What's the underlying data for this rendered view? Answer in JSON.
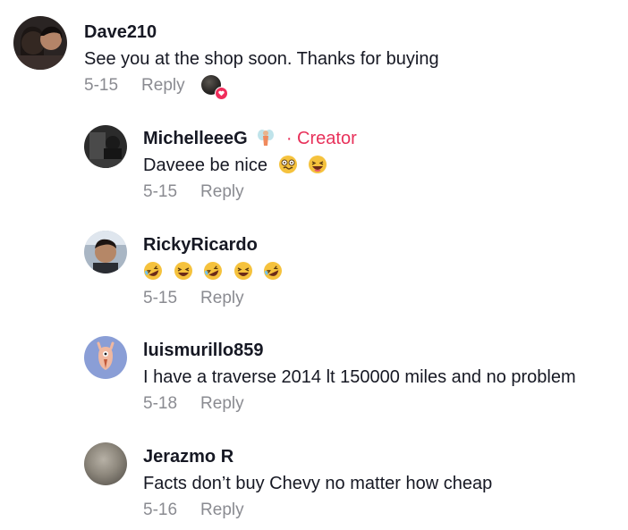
{
  "comments": [
    {
      "username": "Dave210",
      "text": "See you at the shop soon. Thanks for buying",
      "date": "5-15",
      "reply_label": "Reply",
      "liked_by_creator": true
    },
    {
      "username": "MichelleeeG",
      "username_icon": "fairy-emoji",
      "creator_tag": "· Creator",
      "text": "Daveee be nice",
      "text_emojis": [
        "woozy-face-emoji",
        "laughing-face-emoji"
      ],
      "date": "5-15",
      "reply_label": "Reply"
    },
    {
      "username": "RickyRicardo",
      "text": "",
      "text_emojis": [
        "rofl-emoji",
        "laughing-face-emoji",
        "rofl-emoji",
        "laughing-face-emoji",
        "rofl-emoji"
      ],
      "date": "5-15",
      "reply_label": "Reply"
    },
    {
      "username": "luismurillo859",
      "text": "I have a traverse 2014 lt 150000 miles and no problem",
      "date": "5-18",
      "reply_label": "Reply"
    },
    {
      "username": "Jerazmo R",
      "text": "Facts don’t buy Chevy no matter how cheap",
      "date": "5-16",
      "reply_label": "Reply"
    }
  ],
  "colors": {
    "creator_accent": "#e8315a",
    "meta_gray": "#8a8b91",
    "text": "#161823"
  }
}
